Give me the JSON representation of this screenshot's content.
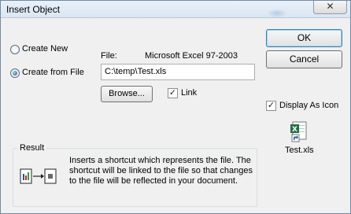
{
  "window": {
    "title": "Insert Object",
    "close_glyph": "✕"
  },
  "buttons": {
    "ok": "OK",
    "cancel": "Cancel",
    "browse": "Browse..."
  },
  "options": {
    "create_new": "Create New",
    "create_from_file": "Create from File",
    "selected": "create_from_file"
  },
  "file": {
    "label": "File:",
    "type": "Microsoft Excel 97-2003",
    "path": "C:\\temp\\Test.xls"
  },
  "link": {
    "label": "Link",
    "checked": true
  },
  "display_as_icon": {
    "label": "Display As Icon",
    "checked": true,
    "icon_caption": "Test.xls"
  },
  "result": {
    "legend": "Result",
    "lines": [
      "Inserts a shortcut which represents the file.  The",
      "shortcut will be linked to the file so that changes",
      "to the file will be reflected in your document."
    ]
  },
  "check_glyph": "✓",
  "colors": {
    "excel_green": "#1e7145",
    "shortcut_blue": "#1d5aa8"
  }
}
